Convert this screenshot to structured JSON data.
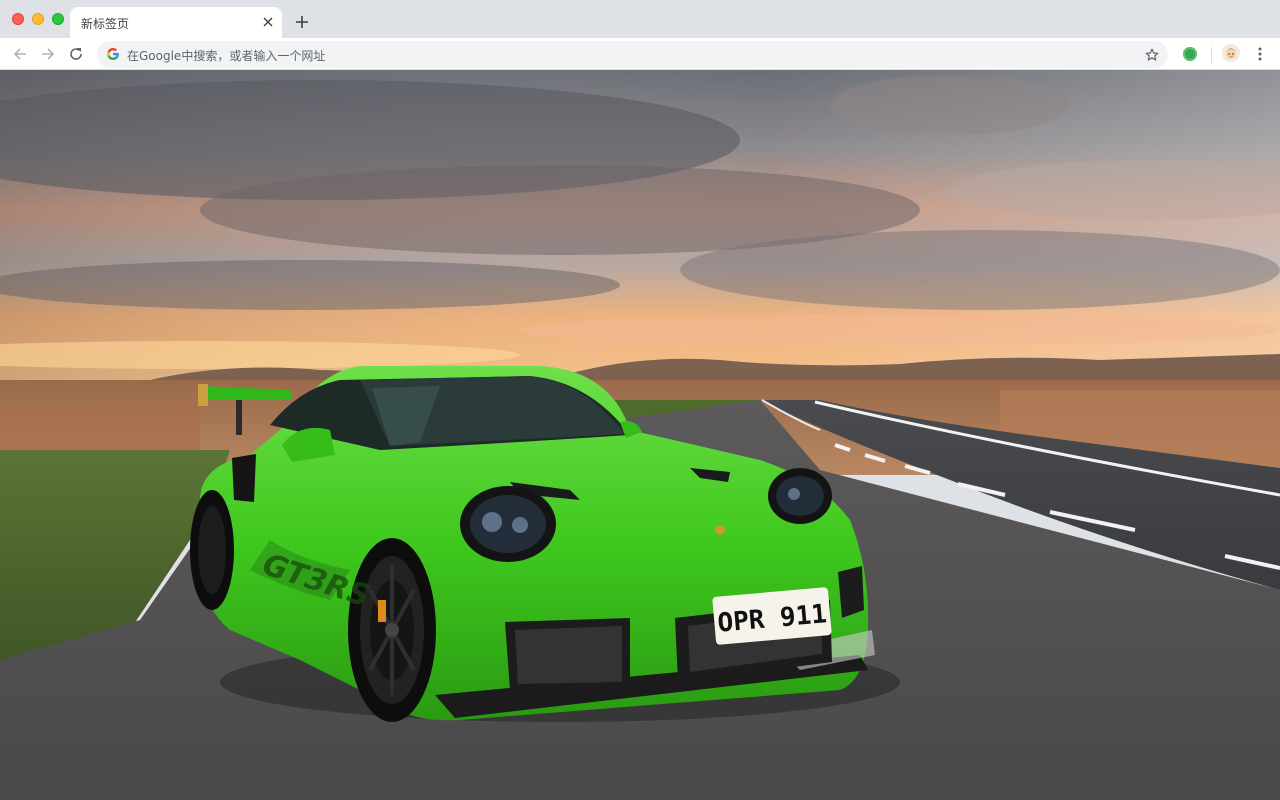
{
  "window": {
    "controls": {
      "close_icon": "close-circle",
      "minimize_icon": "minimize-circle",
      "maximize_icon": "maximize-circle"
    }
  },
  "tabs": [
    {
      "title": "新标签页",
      "active": true
    }
  ],
  "toolbar": {
    "back_icon": "arrow-left-icon",
    "forward_icon": "arrow-right-icon",
    "reload_icon": "reload-icon"
  },
  "omnibox": {
    "placeholder": "在Google中搜索，或者输入一个网址",
    "value": ""
  },
  "wallpaper": {
    "description_icon": "background-image",
    "license_plate": "OPR 911",
    "car_body_color": "#3fc81e",
    "sky_color": "#c9c1bc"
  },
  "colors": {
    "tabstrip_bg": "#dee1e6",
    "omnibox_bg": "#f1f3f4",
    "accent_green": "#34a853"
  }
}
